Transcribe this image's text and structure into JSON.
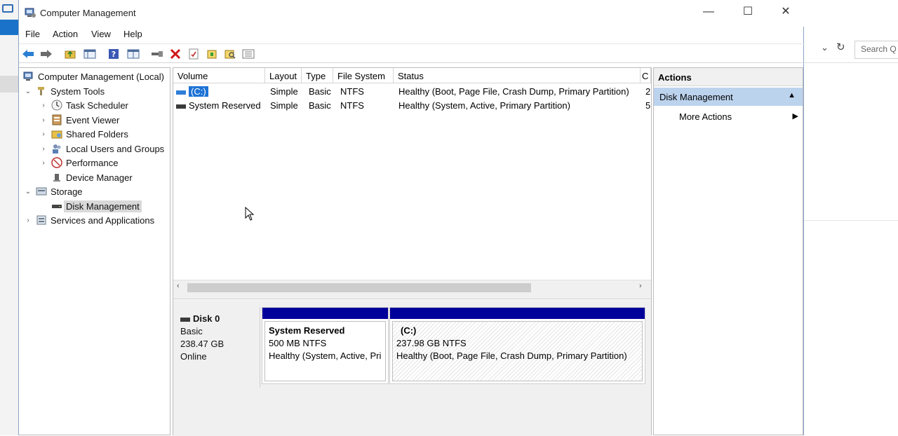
{
  "background": {
    "search_placeholder": "Search Q"
  },
  "window": {
    "title": "Computer Management",
    "controls": {
      "minimize": "—",
      "maximize": "☐",
      "close": "✕"
    }
  },
  "menu": [
    "File",
    "Action",
    "View",
    "Help"
  ],
  "tree": {
    "root": "Computer Management (Local)",
    "system_tools": "System Tools",
    "task_scheduler": "Task Scheduler",
    "event_viewer": "Event Viewer",
    "shared_folders": "Shared Folders",
    "local_users": "Local Users and Groups",
    "performance": "Performance",
    "device_manager": "Device Manager",
    "storage": "Storage",
    "disk_management": "Disk Management",
    "services": "Services and Applications"
  },
  "volumes": {
    "columns": [
      "Volume",
      "Layout",
      "Type",
      "File System",
      "Status",
      "C"
    ],
    "rows": [
      {
        "volume": "(C:)",
        "layout": "Simple",
        "type": "Basic",
        "fs": "NTFS",
        "status": "Healthy (Boot, Page File, Crash Dump, Primary Partition)",
        "extra": "2"
      },
      {
        "volume": "System Reserved",
        "layout": "Simple",
        "type": "Basic",
        "fs": "NTFS",
        "status": "Healthy (System, Active, Primary Partition)",
        "extra": "5"
      }
    ]
  },
  "disk": {
    "name": "Disk 0",
    "kind": "Basic",
    "size": "238.47 GB",
    "state": "Online",
    "partitions": [
      {
        "title": "System Reserved",
        "size": "500 MB NTFS",
        "status": "Healthy (System, Active, Pri"
      },
      {
        "title": "(C:)",
        "size": "237.98 GB NTFS",
        "status": "Healthy (Boot, Page File, Crash Dump, Primary Partition)"
      }
    ]
  },
  "actions": {
    "header": "Actions",
    "section": "Disk Management",
    "more": "More Actions"
  },
  "colors": {
    "partition_header": "#00009a",
    "selection": "#1e72d6",
    "actions_selected": "#bcd3ee"
  }
}
